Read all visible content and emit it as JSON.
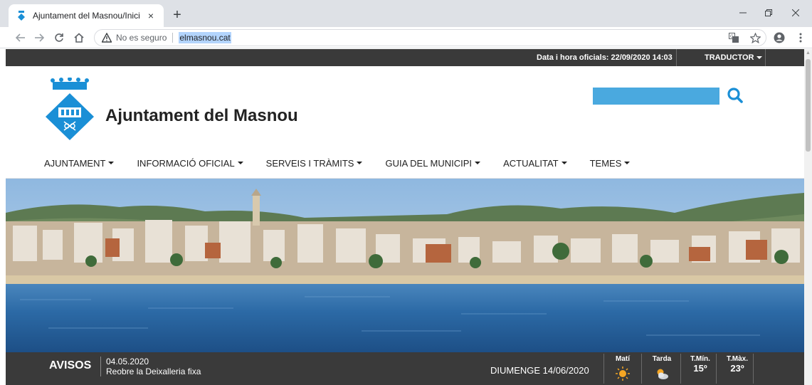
{
  "browser": {
    "tab_title": "Ajuntament del Masnou/Inici",
    "tab_close": "×",
    "new_tab": "+",
    "not_secure": "No es seguro",
    "url": "elmasnou.cat"
  },
  "site": {
    "official_datetime": "Data i hora oficials: 22/09/2020 14:03",
    "translator_label": "TRADUCTOR",
    "title": "Ajuntament del Masnou",
    "search_placeholder": "",
    "nav": [
      {
        "label": "AJUNTAMENT"
      },
      {
        "label": "INFORMACIÓ OFICIAL"
      },
      {
        "label": "SERVEIS I TRÀMITS"
      },
      {
        "label": "GUIA DEL MUNICIPI"
      },
      {
        "label": "ACTUALITAT"
      },
      {
        "label": "TEMES"
      }
    ]
  },
  "notices": {
    "title": "AVISOS",
    "date": "04.05.2020",
    "text": "Reobre la Deixalleria fixa"
  },
  "weather": {
    "date": "DIUMENGE 14/06/2020",
    "morning_label": "Matí",
    "afternoon_label": "Tarda",
    "min_label": "T.Mín.",
    "max_label": "T.Màx.",
    "min_temp": "15º",
    "max_temp": "23º"
  },
  "colors": {
    "accent_blue": "#4aa9df",
    "bar_dark": "#3a3a3a"
  }
}
